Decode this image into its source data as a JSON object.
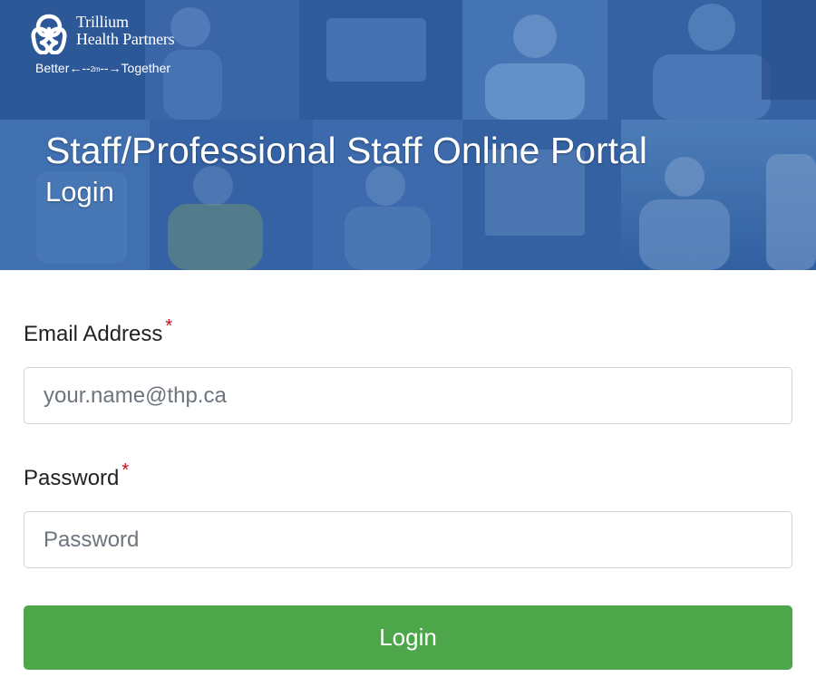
{
  "brand": {
    "name_line1": "Trillium",
    "name_line2": "Health Partners",
    "tagline_left": "Better",
    "tagline_distance": "2m",
    "tagline_right": "Together"
  },
  "header": {
    "title": "Staff/Professional Staff Online Portal",
    "subtitle": "Login"
  },
  "form": {
    "email": {
      "label": "Email Address",
      "required_mark": "*",
      "placeholder": "your.name@thp.ca",
      "value": ""
    },
    "password": {
      "label": "Password",
      "required_mark": "*",
      "placeholder": "Password",
      "value": ""
    },
    "submit_label": "Login"
  },
  "colors": {
    "banner_blue": "#2f5c9e",
    "button_green": "#4ea64a",
    "required_red": "#d0021b"
  }
}
